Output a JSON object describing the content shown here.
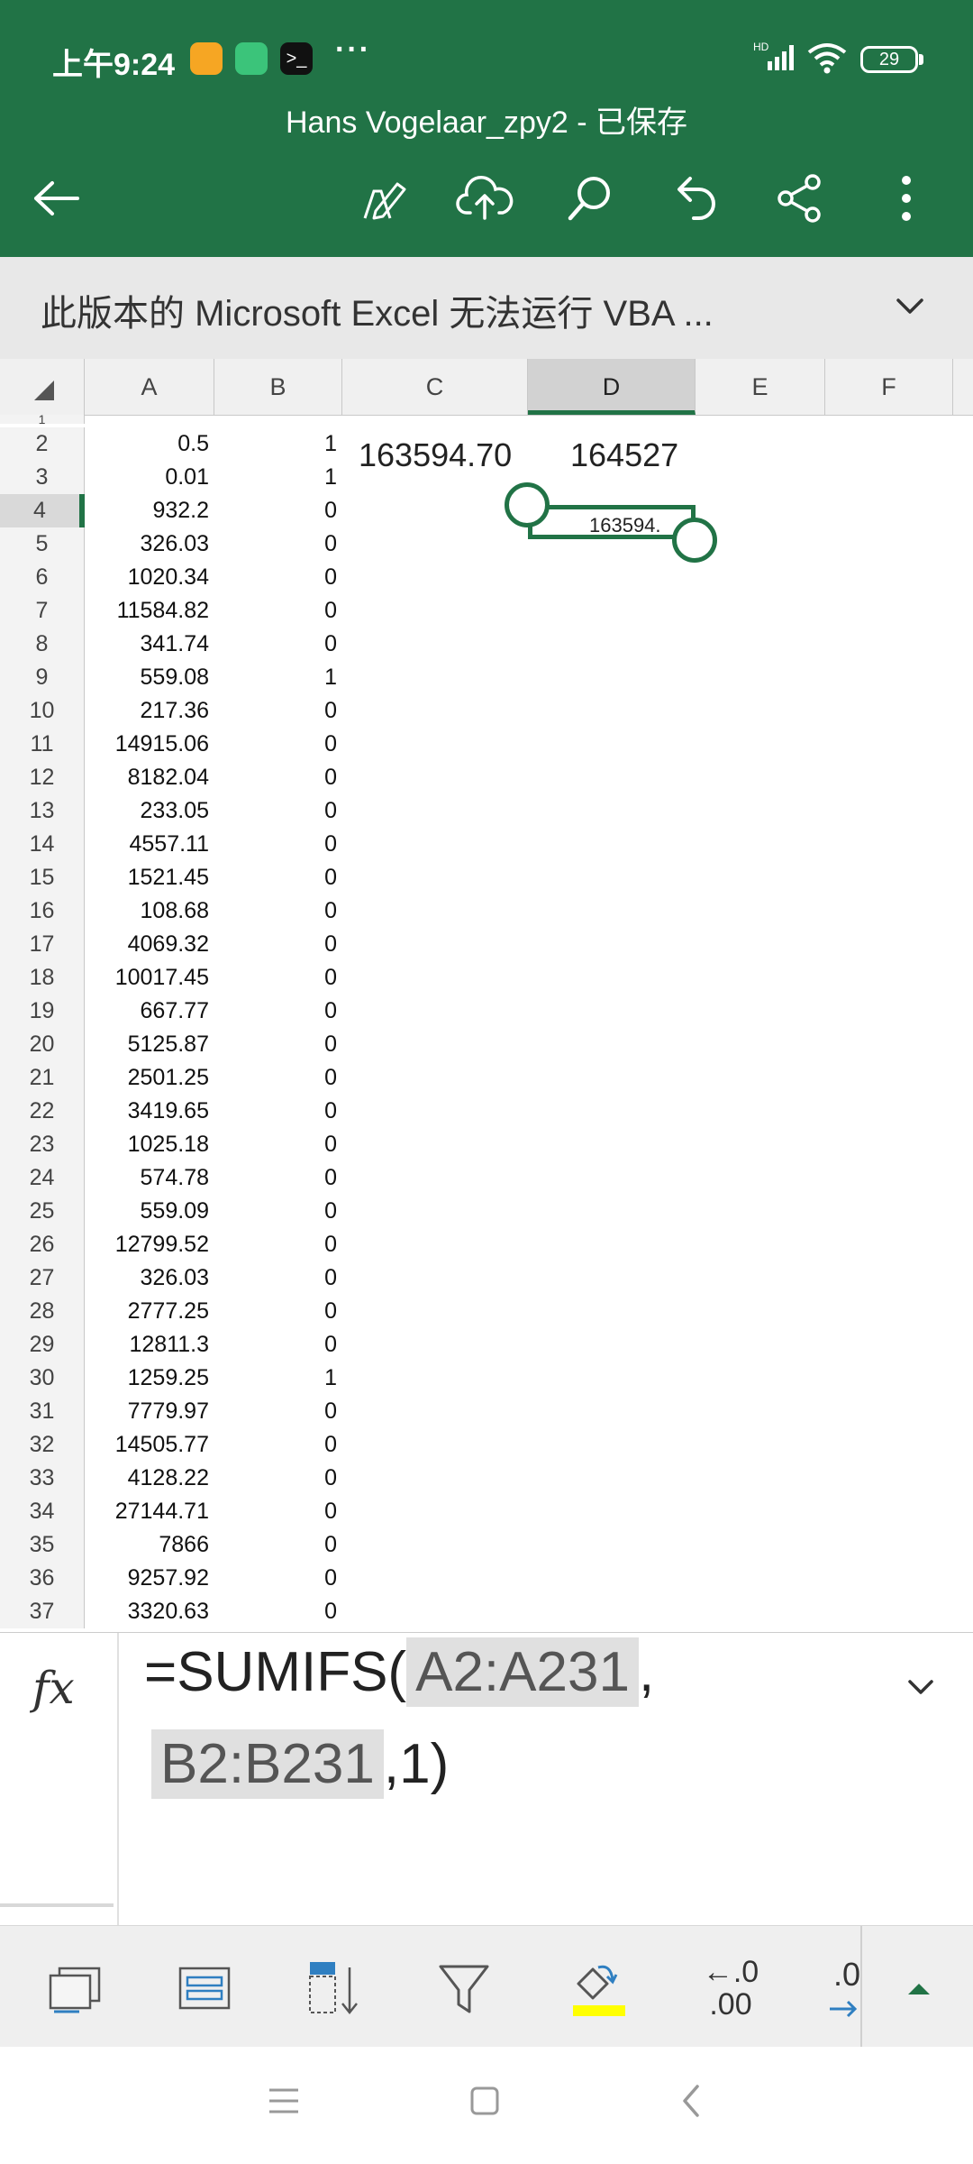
{
  "status_bar": {
    "time": "上午9:24",
    "more": "···",
    "network_label": "HD",
    "battery": "29"
  },
  "title_bar": {
    "document_title": "Hans Vogelaar_zpy2 - 已保存"
  },
  "toolbar_icons": [
    "back-arrow-icon",
    "draw-pen-icon",
    "cloud-upload-icon",
    "search-icon",
    "undo-icon",
    "share-icon",
    "more-vert-icon"
  ],
  "message_bar": {
    "text": "此版本的 Microsoft Excel 无法运行 VBA ..."
  },
  "columns": [
    "A",
    "B",
    "C",
    "D",
    "E",
    "F"
  ],
  "selected_column": "D",
  "row_1_label": "1",
  "rows": [
    {
      "n": "2",
      "a": "0.5",
      "b": "1"
    },
    {
      "n": "3",
      "a": "0.01",
      "b": "1"
    },
    {
      "n": "4",
      "a": "932.2",
      "b": "0"
    },
    {
      "n": "5",
      "a": "326.03",
      "b": "0"
    },
    {
      "n": "6",
      "a": "1020.34",
      "b": "0"
    },
    {
      "n": "7",
      "a": "11584.82",
      "b": "0"
    },
    {
      "n": "8",
      "a": "341.74",
      "b": "0"
    },
    {
      "n": "9",
      "a": "559.08",
      "b": "1"
    },
    {
      "n": "10",
      "a": "217.36",
      "b": "0"
    },
    {
      "n": "11",
      "a": "14915.06",
      "b": "0"
    },
    {
      "n": "12",
      "a": "8182.04",
      "b": "0"
    },
    {
      "n": "13",
      "a": "233.05",
      "b": "0"
    },
    {
      "n": "14",
      "a": "4557.11",
      "b": "0"
    },
    {
      "n": "15",
      "a": "1521.45",
      "b": "0"
    },
    {
      "n": "16",
      "a": "108.68",
      "b": "0"
    },
    {
      "n": "17",
      "a": "4069.32",
      "b": "0"
    },
    {
      "n": "18",
      "a": "10017.45",
      "b": "0"
    },
    {
      "n": "19",
      "a": "667.77",
      "b": "0"
    },
    {
      "n": "20",
      "a": "5125.87",
      "b": "0"
    },
    {
      "n": "21",
      "a": "2501.25",
      "b": "0"
    },
    {
      "n": "22",
      "a": "3419.65",
      "b": "0"
    },
    {
      "n": "23",
      "a": "1025.18",
      "b": "0"
    },
    {
      "n": "24",
      "a": "574.78",
      "b": "0"
    },
    {
      "n": "25",
      "a": "559.09",
      "b": "0"
    },
    {
      "n": "26",
      "a": "12799.52",
      "b": "0"
    },
    {
      "n": "27",
      "a": "326.03",
      "b": "0"
    },
    {
      "n": "28",
      "a": "2777.25",
      "b": "0"
    },
    {
      "n": "29",
      "a": "12811.3",
      "b": "0"
    },
    {
      "n": "30",
      "a": "1259.25",
      "b": "1"
    },
    {
      "n": "31",
      "a": "7779.97",
      "b": "0"
    },
    {
      "n": "32",
      "a": "14505.77",
      "b": "0"
    },
    {
      "n": "33",
      "a": "4128.22",
      "b": "0"
    },
    {
      "n": "34",
      "a": "27144.71",
      "b": "0"
    },
    {
      "n": "35",
      "a": "7866",
      "b": "0"
    },
    {
      "n": "36",
      "a": "9257.92",
      "b": "0"
    },
    {
      "n": "37",
      "a": "3320.63",
      "b": "0"
    }
  ],
  "cells": {
    "c2": "163594.70",
    "d2": "164527",
    "d4": "163594."
  },
  "formula_bar": {
    "fx_label": "fx",
    "part1": "=SUMIFS(",
    "ref1": "A2:A231",
    "comma": ",",
    "ref2": "B2:B231",
    "part2": ",1)"
  },
  "ribbon_icons": [
    "insert-picture-icon",
    "format-table-icon",
    "sort-icon",
    "filter-icon",
    "fill-color-icon",
    "decrease-decimal-icon",
    "increase-decimal-icon",
    "expand-ribbon-icon"
  ],
  "ribbon_labels": {
    "decimal_top": "←.0",
    "decimal_bottom": ".00"
  },
  "colors": {
    "brand_green": "#217346",
    "fill_highlight": "#ffff00"
  }
}
